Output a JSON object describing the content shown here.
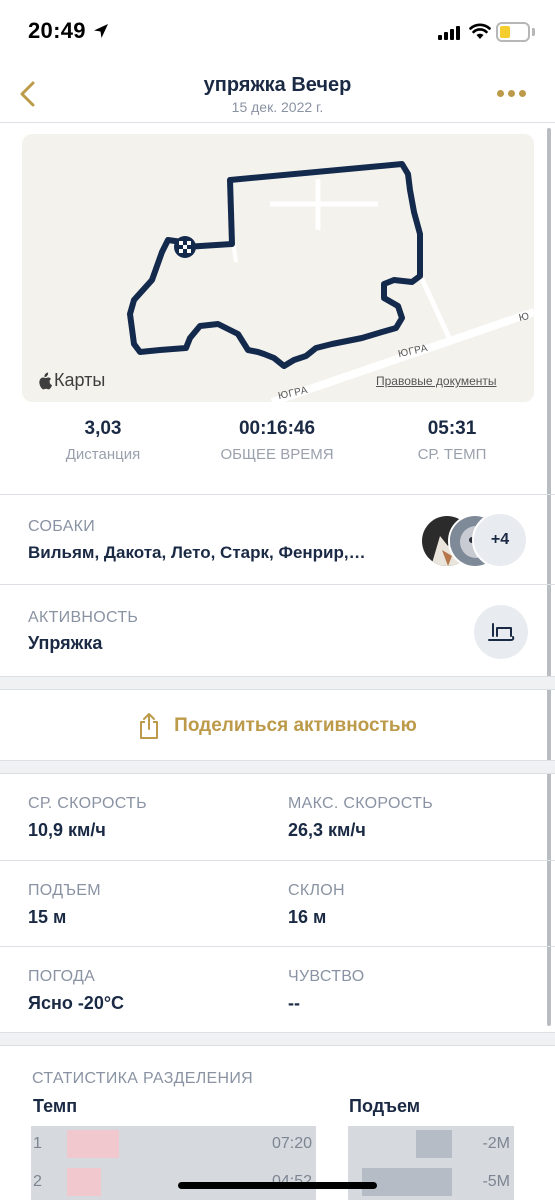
{
  "status_bar": {
    "time": "20:49"
  },
  "nav": {
    "title": "упряжка Вечер",
    "subtitle": "15 дек. 2022 г."
  },
  "map": {
    "brand": "Карты",
    "legal": "Правовые документы",
    "roads": [
      "ЮГРА",
      "ЮГРА",
      "Ю"
    ]
  },
  "summary": [
    {
      "value": "3,03",
      "label": "Дистанция"
    },
    {
      "value": "00:16:46",
      "label": "ОБЩЕЕ ВРЕМЯ"
    },
    {
      "value": "05:31",
      "label": "СР. ТЕМП"
    }
  ],
  "dogs": {
    "label": "СОБАКИ",
    "names": "Вильям, Дакота, Лето, Старк, Фенрир,…",
    "more_count": "+4"
  },
  "activity": {
    "label": "АКТИВНОСТЬ",
    "value": "Упряжка",
    "icon": "sled-icon"
  },
  "share": {
    "label": "Поделиться активностью"
  },
  "stats": [
    {
      "label": "СР. СКОРОСТЬ",
      "value": "10,9 км/ч"
    },
    {
      "label": "МАКС. СКОРОСТЬ",
      "value": "26,3 км/ч"
    },
    {
      "label": "ПОДЪЕМ",
      "value": "15 м"
    },
    {
      "label": "СКЛОН",
      "value": "16 м"
    },
    {
      "label": "ПОГОДА",
      "value": "Ясно -20°C"
    },
    {
      "label": "ЧУВСТВО",
      "value": "--"
    }
  ],
  "splits": {
    "title": "СТАТИСТИКА РАЗДЕЛЕНИЯ",
    "pace_header": "Темп",
    "elev_header": "Подъем",
    "pace_rows": [
      {
        "index": "1",
        "value": "07:20"
      },
      {
        "index": "2",
        "value": "04:52"
      }
    ],
    "elev_rows": [
      {
        "value": "-2М"
      },
      {
        "value": "-5М"
      }
    ]
  },
  "colors": {
    "accent": "#bc9a4a",
    "text": "#1b2a44",
    "muted": "#8a93a3",
    "route": "#142a4d"
  }
}
